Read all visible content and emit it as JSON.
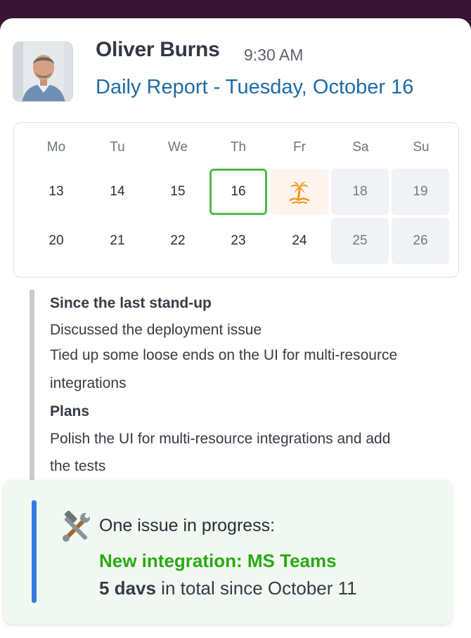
{
  "header": {
    "user_name": "Oliver Burns",
    "time": "9:30 AM",
    "subtitle": "Daily Report - Tuesday, October 16"
  },
  "calendar": {
    "weekdays": [
      "Mo",
      "Tu",
      "We",
      "Th",
      "Fr",
      "Sa",
      "Su"
    ],
    "week1": [
      "13",
      "14",
      "15",
      "16",
      "",
      "18",
      "19"
    ],
    "week2": [
      "20",
      "21",
      "22",
      "23",
      "24",
      "25",
      "26"
    ],
    "today": "16",
    "vacation_icon": "palm-tree-island-icon",
    "colors": {
      "today_border": "#4cbb4a",
      "weekend_bg": "#f0f2f5",
      "vacation_bg": "#fdf4ee",
      "vacation_icon": "#f5951d"
    }
  },
  "standup": {
    "since_heading": "Since the last stand-up",
    "since_items": [
      "Discussed the deployment issue",
      "Tied up some loose ends on the UI for multi-resource",
      "integrations"
    ],
    "plans_heading": "Plans",
    "plans_items": [
      "Polish the UI for multi-resource integrations and add",
      "the tests"
    ]
  },
  "issue": {
    "icon": "hammer-and-wrench-icon",
    "title": "One issue in progress:",
    "link": "New integration: MS Teams",
    "duration": "5 davs",
    "duration_suffix": " in total since October 11",
    "colors": {
      "link": "#2aa914",
      "accent": "#2f7de1",
      "background": "#f1f8f1"
    }
  },
  "colors": {
    "subtitle": "#1e6aa6",
    "window_bg": "#3a1433"
  }
}
